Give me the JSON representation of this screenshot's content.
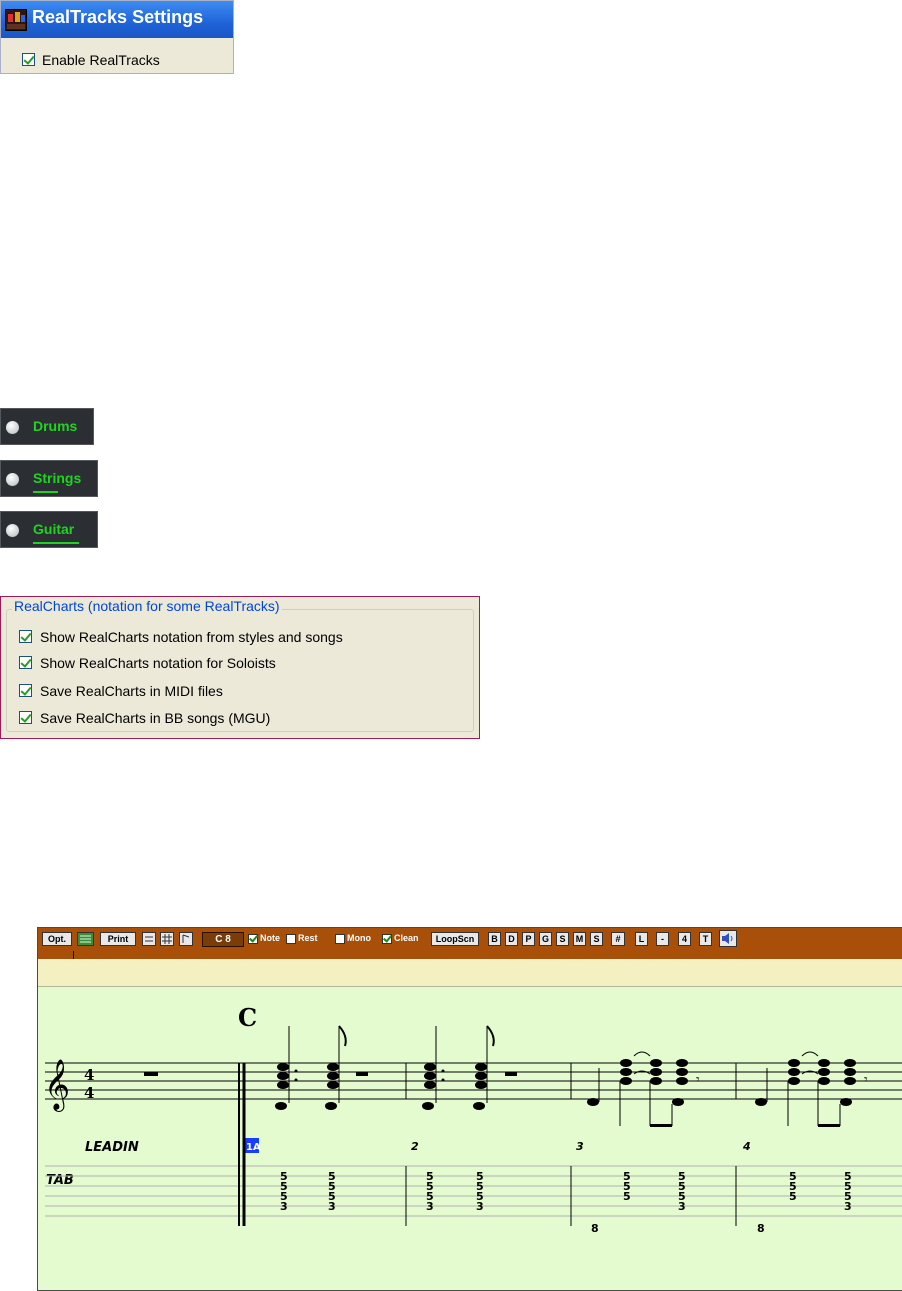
{
  "realtracks_settings": {
    "title": "RealTracks Settings",
    "enable_label": "Enable RealTracks",
    "enable_checked": true
  },
  "instruments": [
    {
      "label": "Drums",
      "selected": false,
      "underlined": false
    },
    {
      "label": "Strings",
      "selected": false,
      "underlined": true
    },
    {
      "label": "Guitar",
      "selected": false,
      "underlined": true
    }
  ],
  "realcharts": {
    "legend": "RealCharts (notation for some RealTracks)",
    "options": [
      {
        "label": "Show RealCharts notation from styles and songs",
        "checked": true
      },
      {
        "label": "Show RealCharts notation for Soloists",
        "checked": true
      },
      {
        "label": "Save RealCharts in MIDI files",
        "checked": true
      },
      {
        "label": "Save RealCharts in BB songs (MGU)",
        "checked": true
      }
    ]
  },
  "notation_window": {
    "toolbar": {
      "opt": "Opt.",
      "print": "Print",
      "key": "C 8",
      "note": "Note",
      "rest": "Rest",
      "mono": "Mono",
      "clean": "Clean",
      "loopscn": "LoopScn",
      "letters": [
        "B",
        "D",
        "P",
        "G",
        "S",
        "M",
        "S",
        "#",
        "L",
        "-",
        "4",
        "T"
      ]
    },
    "score": {
      "chord": "C",
      "time_sig": [
        "4",
        "4"
      ],
      "leadin": "LEADIN",
      "bars": [
        "1A",
        "2",
        "3",
        "4"
      ],
      "tab_label": "TAB",
      "tab_bar1": [
        "5",
        "5",
        "5",
        "3"
      ],
      "tab_bar3": [
        "5",
        "5",
        "5",
        "3"
      ],
      "tab_eighth": [
        "5",
        "5",
        "5"
      ],
      "tab_bass": "8"
    },
    "colors": {
      "toolbar": "#a8500a",
      "band": "#f4f0c2",
      "score_bg": "#e4fbcf",
      "bar_label_bg": "#1a3cff"
    }
  }
}
